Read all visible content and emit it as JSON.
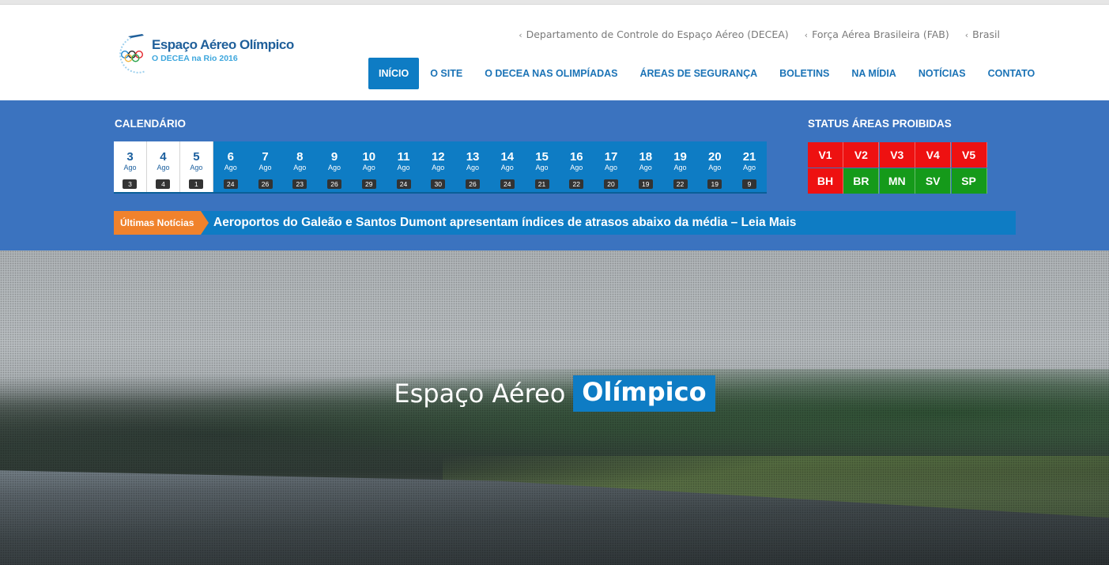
{
  "logo": {
    "title": "Espaço Aéreo Olímpico",
    "subtitle": "O DECEA na Rio 2016"
  },
  "toplinks": [
    {
      "label": "Departamento de Controle do Espaço Aéreo (DECEA)"
    },
    {
      "label": "Força Aérea Brasileira (FAB)"
    },
    {
      "label": "Brasil"
    }
  ],
  "nav": [
    {
      "label": "INÍCIO",
      "active": true
    },
    {
      "label": "O SITE"
    },
    {
      "label": "O DECEA NAS OLIMPÍADAS"
    },
    {
      "label": "ÁREAS DE SEGURANÇA"
    },
    {
      "label": "BOLETINS"
    },
    {
      "label": "NA MÍDIA"
    },
    {
      "label": "NOTÍCIAS"
    },
    {
      "label": "CONTATO"
    }
  ],
  "calendar": {
    "title": "CALENDÁRIO",
    "days": [
      {
        "day": "3",
        "month": "Ago",
        "count": "3",
        "past": true
      },
      {
        "day": "4",
        "month": "Ago",
        "count": "4",
        "past": true
      },
      {
        "day": "5",
        "month": "Ago",
        "count": "1",
        "past": true
      },
      {
        "day": "6",
        "month": "Ago",
        "count": "24"
      },
      {
        "day": "7",
        "month": "Ago",
        "count": "26"
      },
      {
        "day": "8",
        "month": "Ago",
        "count": "23"
      },
      {
        "day": "9",
        "month": "Ago",
        "count": "26"
      },
      {
        "day": "10",
        "month": "Ago",
        "count": "29"
      },
      {
        "day": "11",
        "month": "Ago",
        "count": "24"
      },
      {
        "day": "12",
        "month": "Ago",
        "count": "30"
      },
      {
        "day": "13",
        "month": "Ago",
        "count": "26"
      },
      {
        "day": "14",
        "month": "Ago",
        "count": "24"
      },
      {
        "day": "15",
        "month": "Ago",
        "count": "21"
      },
      {
        "day": "16",
        "month": "Ago",
        "count": "22"
      },
      {
        "day": "17",
        "month": "Ago",
        "count": "20"
      },
      {
        "day": "18",
        "month": "Ago",
        "count": "19"
      },
      {
        "day": "19",
        "month": "Ago",
        "count": "22"
      },
      {
        "day": "20",
        "month": "Ago",
        "count": "19"
      },
      {
        "day": "21",
        "month": "Ago",
        "count": "9"
      }
    ]
  },
  "status": {
    "title": "STATUS ÁREAS PROIBIDAS",
    "colors": {
      "red": "#ee1111",
      "green": "#159a1a"
    },
    "rows": [
      [
        {
          "label": "V1",
          "state": "red"
        },
        {
          "label": "V2",
          "state": "red"
        },
        {
          "label": "V3",
          "state": "red"
        },
        {
          "label": "V4",
          "state": "red"
        },
        {
          "label": "V5",
          "state": "red"
        }
      ],
      [
        {
          "label": "BH",
          "state": "red"
        },
        {
          "label": "BR",
          "state": "green"
        },
        {
          "label": "MN",
          "state": "green"
        },
        {
          "label": "SV",
          "state": "green"
        },
        {
          "label": "SP",
          "state": "green"
        }
      ]
    ]
  },
  "ticker": {
    "label": "Últimas Notícias",
    "text": "Aeroportos do Galeão e Santos Dumont apresentam índices de atrasos abaixo da média – Leia Mais"
  },
  "hero": {
    "light": "Espaço Aéreo",
    "strong": "Olímpico"
  },
  "colors": {
    "accent": "#0e7cc4",
    "band": "#3b73bf",
    "ticker_label": "#f0822c",
    "nav_text": "#1b73b6"
  }
}
